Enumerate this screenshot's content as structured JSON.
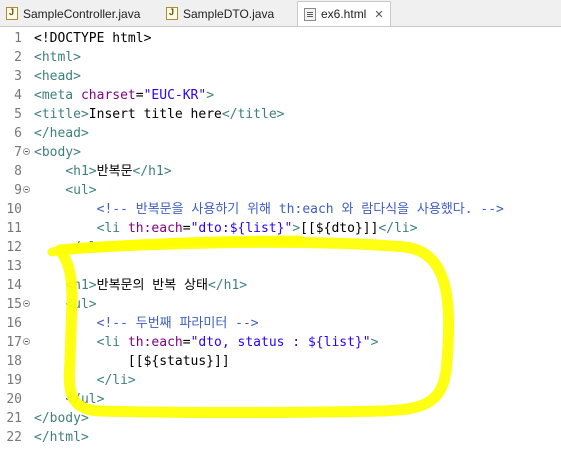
{
  "tabs": [
    {
      "label": "SampleController.java",
      "icon": "java-file-icon",
      "active": false
    },
    {
      "label": "SampleDTO.java",
      "icon": "java-file-icon",
      "active": false
    },
    {
      "label": "ex6.html",
      "icon": "html-file-icon",
      "active": true,
      "close": "✕"
    }
  ],
  "lines": [
    {
      "n": "1",
      "tokens": [
        [
          "ink",
          "<!DOCTYPE html>"
        ]
      ]
    },
    {
      "n": "2",
      "tokens": [
        [
          "tag",
          "<html>"
        ]
      ]
    },
    {
      "n": "3",
      "tokens": [
        [
          "tag",
          "<head>"
        ]
      ]
    },
    {
      "n": "4",
      "tokens": [
        [
          "tag",
          "<meta "
        ],
        [
          "attr",
          "charset"
        ],
        [
          "ink",
          "="
        ],
        [
          "val",
          "\"EUC-KR\""
        ],
        [
          "tag",
          ">"
        ]
      ]
    },
    {
      "n": "5",
      "tokens": [
        [
          "tag",
          "<title>"
        ],
        [
          "ink",
          "Insert title here"
        ],
        [
          "tag",
          "</title>"
        ]
      ]
    },
    {
      "n": "6",
      "tokens": [
        [
          "tag",
          "</head>"
        ]
      ]
    },
    {
      "n": "7",
      "fold": true,
      "tokens": [
        [
          "tag",
          "<body>"
        ]
      ]
    },
    {
      "n": "8",
      "tokens": [
        [
          "ink",
          "    "
        ],
        [
          "tag",
          "<h1>"
        ],
        [
          "ink",
          "반복문"
        ],
        [
          "tag",
          "</h1>"
        ]
      ]
    },
    {
      "n": "9",
      "fold": true,
      "tokens": [
        [
          "ink",
          "    "
        ],
        [
          "tag",
          "<ul>"
        ]
      ]
    },
    {
      "n": "10",
      "tokens": [
        [
          "ink",
          "        "
        ],
        [
          "cmt",
          "<!-- 반복문을 사용하기 위해 th:each 와 람다식을 사용했다. -->"
        ]
      ]
    },
    {
      "n": "11",
      "tokens": [
        [
          "ink",
          "        "
        ],
        [
          "tag",
          "<li "
        ],
        [
          "attr",
          "th:each"
        ],
        [
          "ink",
          "="
        ],
        [
          "val",
          "\"dto:${list}\""
        ],
        [
          "tag",
          ">"
        ],
        [
          "ink",
          "[[${dto}]]"
        ],
        [
          "tag",
          "</li>"
        ]
      ]
    },
    {
      "n": "12",
      "tokens": [
        [
          "ink",
          "    "
        ],
        [
          "tag",
          "</ul>"
        ]
      ]
    },
    {
      "n": "13",
      "tokens": [
        [
          "ink",
          ""
        ]
      ]
    },
    {
      "n": "14",
      "tokens": [
        [
          "ink",
          "    "
        ],
        [
          "tag",
          "<h1>"
        ],
        [
          "ink",
          "반복문의 반복 상태"
        ],
        [
          "tag",
          "</h1>"
        ]
      ]
    },
    {
      "n": "15",
      "fold": true,
      "tokens": [
        [
          "ink",
          "    "
        ],
        [
          "tag",
          "<ul>"
        ]
      ]
    },
    {
      "n": "16",
      "tokens": [
        [
          "ink",
          "        "
        ],
        [
          "cmt",
          "<!-- 두번째 파라미터 -->"
        ]
      ]
    },
    {
      "n": "17",
      "fold": true,
      "tokens": [
        [
          "ink",
          "        "
        ],
        [
          "tag",
          "<li "
        ],
        [
          "attr",
          "th:each"
        ],
        [
          "ink",
          "="
        ],
        [
          "val",
          "\"dto, status : ${list}\""
        ],
        [
          "tag",
          ">"
        ]
      ]
    },
    {
      "n": "18",
      "tokens": [
        [
          "ink",
          "            [[${status}]]"
        ]
      ]
    },
    {
      "n": "19",
      "tokens": [
        [
          "ink",
          "        "
        ],
        [
          "tag",
          "</li>"
        ]
      ]
    },
    {
      "n": "20",
      "tokens": [
        [
          "ink",
          "    "
        ],
        [
          "tag",
          "</ul>"
        ]
      ]
    },
    {
      "n": "21",
      "tokens": [
        [
          "tag",
          "</body>"
        ]
      ]
    },
    {
      "n": "22",
      "tokens": [
        [
          "tag",
          "</html>"
        ]
      ]
    }
  ],
  "colors": {
    "highlight": "#ffff00",
    "tag": "#3f7f7f",
    "attr": "#7f007f",
    "value": "#2a00ff",
    "comment": "#3f5fbf",
    "gutter": "#787878"
  }
}
